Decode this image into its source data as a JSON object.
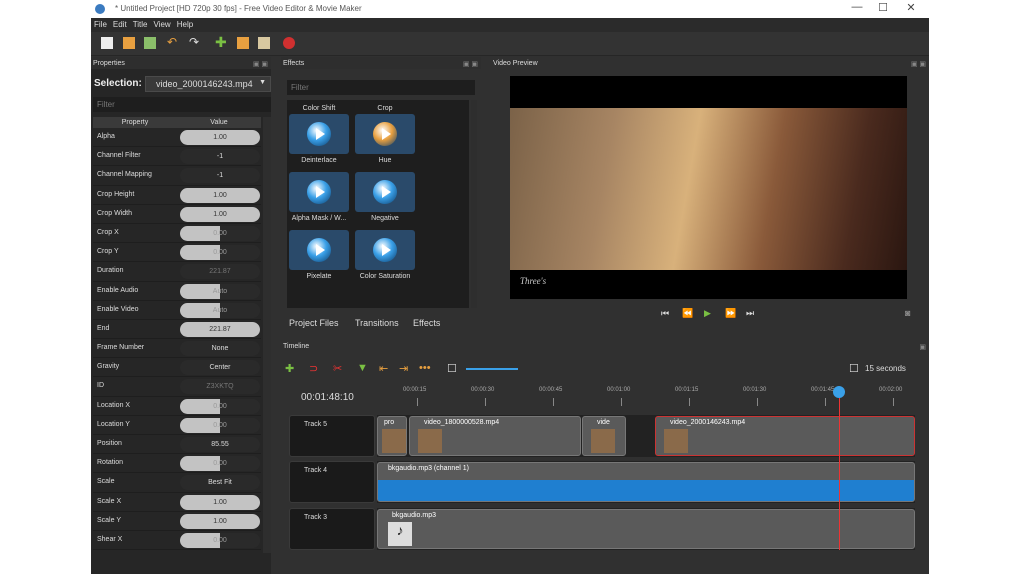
{
  "window": {
    "title": "* Untitled Project [HD 720p 30 fps] - Free Video Editor & Movie Maker",
    "controls": [
      "—",
      "☐",
      "✕"
    ]
  },
  "menu": [
    "File",
    "Edit",
    "Title",
    "View",
    "Help"
  ],
  "panels": {
    "properties": "Properties",
    "effects": "Effects",
    "preview": "Video Preview",
    "timeline": "Timeline"
  },
  "properties": {
    "selection_label": "Selection:",
    "selection_value": "video_2000146243.mp4",
    "filter_placeholder": "Filter",
    "headers": [
      "Property",
      "Value"
    ],
    "rows": [
      {
        "name": "Alpha",
        "value": "1.00",
        "style": "full"
      },
      {
        "name": "Channel Filter",
        "value": "-1",
        "style": "dark"
      },
      {
        "name": "Channel Mapping",
        "value": "-1",
        "style": "dark"
      },
      {
        "name": "Crop Height",
        "value": "1.00",
        "style": "full"
      },
      {
        "name": "Crop Width",
        "value": "1.00",
        "style": "full"
      },
      {
        "name": "Crop X",
        "value": "0.00",
        "style": "half"
      },
      {
        "name": "Crop Y",
        "value": "0.00",
        "style": "half"
      },
      {
        "name": "Duration",
        "value": "221.87",
        "style": "txt"
      },
      {
        "name": "Enable Audio",
        "value": "Auto",
        "style": "half"
      },
      {
        "name": "Enable Video",
        "value": "Auto",
        "style": "half"
      },
      {
        "name": "End",
        "value": "221.87",
        "style": "full"
      },
      {
        "name": "Frame Number",
        "value": "None",
        "style": "dark"
      },
      {
        "name": "Gravity",
        "value": "Center",
        "style": "dark"
      },
      {
        "name": "ID",
        "value": "Z3XKTQ",
        "style": "txt"
      },
      {
        "name": "Location X",
        "value": "0.00",
        "style": "half"
      },
      {
        "name": "Location Y",
        "value": "0.00",
        "style": "half"
      },
      {
        "name": "Position",
        "value": "85.55",
        "style": "dark"
      },
      {
        "name": "Rotation",
        "value": "0.00",
        "style": "half"
      },
      {
        "name": "Scale",
        "value": "Best Fit",
        "style": "dark"
      },
      {
        "name": "Scale X",
        "value": "1.00",
        "style": "full"
      },
      {
        "name": "Scale Y",
        "value": "1.00",
        "style": "full"
      },
      {
        "name": "Shear X",
        "value": "0.00",
        "style": "half"
      }
    ]
  },
  "effects": {
    "filter_placeholder": "Filter",
    "items": [
      "Color Shift",
      "Crop",
      "Deinterlace",
      "Hue",
      "Alpha Mask / W...",
      "Negative",
      "Pixelate",
      "Color Saturation"
    ]
  },
  "tabs": [
    "Project Files",
    "Transitions",
    "Effects"
  ],
  "preview": {
    "watermark": "Three's"
  },
  "timeline": {
    "time": "00:01:48:10",
    "zoom_label": "15 seconds",
    "ruler": [
      "00:00:15",
      "00:00:30",
      "00:00:45",
      "00:01:00",
      "00:01:15",
      "00:01:30",
      "00:01:45",
      "00:02:00"
    ],
    "tracks": [
      {
        "name": "Track 5",
        "clips": [
          "pro",
          "video_1800000528.mp4",
          "vide",
          "video_2000146243.mp4"
        ]
      },
      {
        "name": "Track 4",
        "clips": [
          "bkgaudio.mp3 (channel 1)"
        ]
      },
      {
        "name": "Track 3",
        "clips": [
          "bkgaudio.mp3"
        ]
      }
    ]
  }
}
